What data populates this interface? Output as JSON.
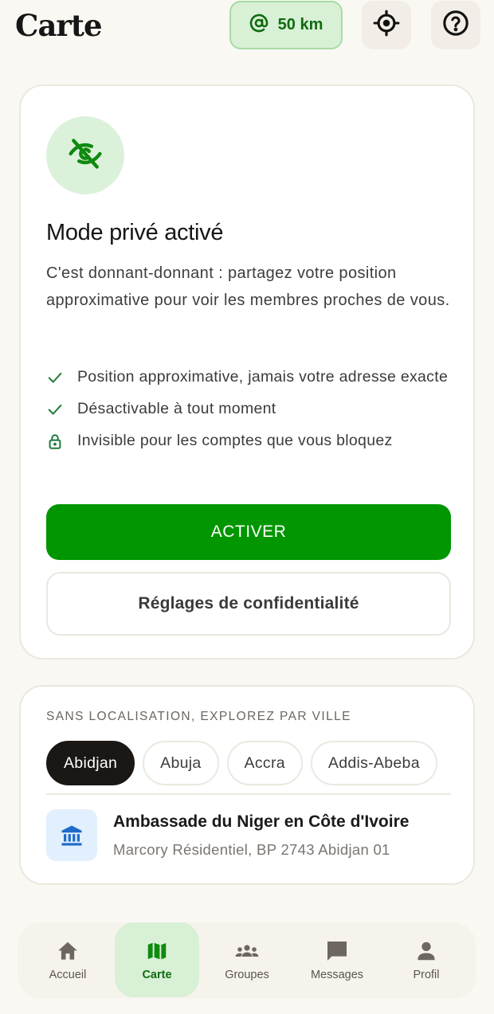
{
  "header": {
    "title": "Carte",
    "radius_label": "50 km",
    "radius_icon": "at-sign-icon",
    "locate_icon": "crosshair-icon",
    "help_icon": "help-circle-icon"
  },
  "private_mode": {
    "icon": "eye-off-icon",
    "title": "Mode privé activé",
    "description": "C'est donnant-donnant : partagez votre position approximative pour voir les membres proches de vous.",
    "features": [
      {
        "icon": "check-icon",
        "text": "Position approximative, jamais votre adresse exacte"
      },
      {
        "icon": "check-icon",
        "text": "Désactivable à tout moment"
      },
      {
        "icon": "lock-icon",
        "text": "Invisible pour les comptes que vous bloquez"
      }
    ],
    "activate_label": "ACTIVER",
    "privacy_settings_label": "Réglages de confidentialité"
  },
  "cities": {
    "heading": "SANS LOCALISATION, EXPLOREZ PAR VILLE",
    "items": [
      "Abidjan",
      "Abuja",
      "Accra",
      "Addis-Abeba"
    ],
    "selected": "Abidjan",
    "place": {
      "icon": "bank-icon",
      "name": "Ambassade du Niger en Côte d'Ivoire",
      "address": "Marcory Résidentiel, BP 2743 Abidjan 01"
    }
  },
  "nav": {
    "items": [
      {
        "label": "Accueil",
        "icon": "home-icon"
      },
      {
        "label": "Carte",
        "icon": "map-icon",
        "active": true
      },
      {
        "label": "Groupes",
        "icon": "groups-icon"
      },
      {
        "label": "Messages",
        "icon": "chat-icon"
      },
      {
        "label": "Profil",
        "icon": "user-icon"
      }
    ]
  },
  "colors": {
    "brand_green": "#029602",
    "chip_green_bg": "#d8f0d6",
    "background": "#faf8f3",
    "selected_chip": "#1a1714",
    "place_icon_blue": "#1e6bc9"
  }
}
